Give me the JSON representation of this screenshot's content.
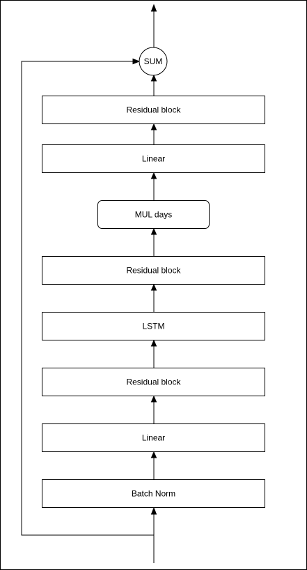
{
  "diagram": {
    "nodes": {
      "sum": "SUM",
      "residual_block_top": "Residual block",
      "linear_top": "Linear",
      "mul_days": "MUL days",
      "residual_block_middle": "Residual block",
      "lstm": "LSTM",
      "residual_block_lower": "Residual block",
      "linear_bottom": "Linear",
      "batch_norm": "Batch Norm"
    }
  }
}
